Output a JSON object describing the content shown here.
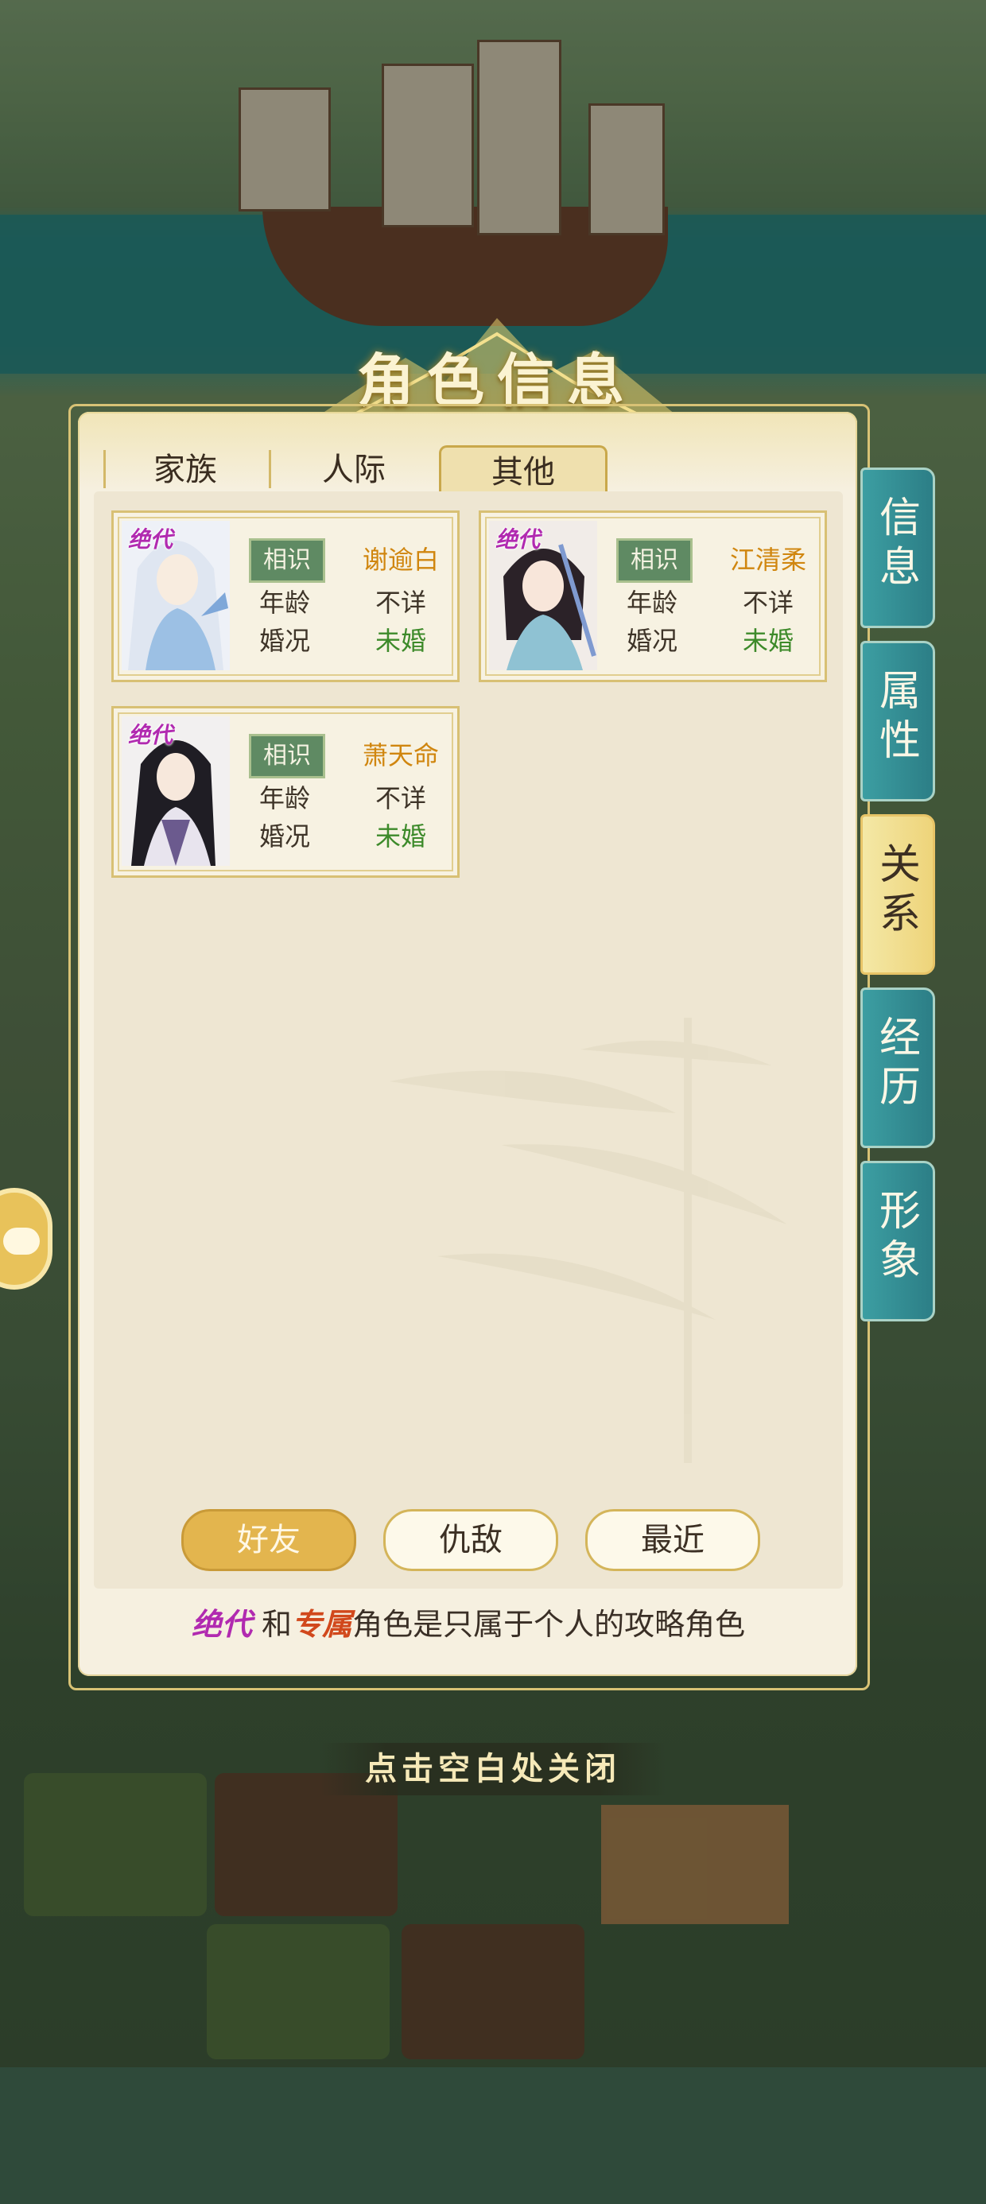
{
  "title": "角色信息",
  "tabs": [
    {
      "label": "家族",
      "active": false
    },
    {
      "label": "人际",
      "active": false
    },
    {
      "label": "其他",
      "active": true
    }
  ],
  "characters": [
    {
      "badge": "绝代",
      "relation": "相识",
      "name": "谢逾白",
      "age_label": "年龄",
      "age_value": "不详",
      "marriage_label": "婚况",
      "marriage_value": "未婚"
    },
    {
      "badge": "绝代",
      "relation": "相识",
      "name": "江清柔",
      "age_label": "年龄",
      "age_value": "不详",
      "marriage_label": "婚况",
      "marriage_value": "未婚"
    },
    {
      "badge": "绝代",
      "relation": "相识",
      "name": "萧天命",
      "age_label": "年龄",
      "age_value": "不详",
      "marriage_label": "婚况",
      "marriage_value": "未婚"
    }
  ],
  "filters": [
    {
      "label": "好友",
      "active": true
    },
    {
      "label": "仇敌",
      "active": false
    },
    {
      "label": "最近",
      "active": false
    }
  ],
  "note": {
    "quality1": "绝代",
    "join": "和",
    "quality2": "专属",
    "text": "角色是只属于个人的攻略角色"
  },
  "side_tabs": [
    {
      "label": "信息",
      "active": false
    },
    {
      "label": "属性",
      "active": false
    },
    {
      "label": "关系",
      "active": true
    },
    {
      "label": "经历",
      "active": false
    },
    {
      "label": "形象",
      "active": false
    }
  ],
  "close_hint": "点击空白处关闭",
  "colors": {
    "name": "#d0860f",
    "single": "#3d8a2a",
    "badge": "#b12ab0",
    "side_tab": "#2c7e86",
    "active_tab": "#eed47a"
  }
}
